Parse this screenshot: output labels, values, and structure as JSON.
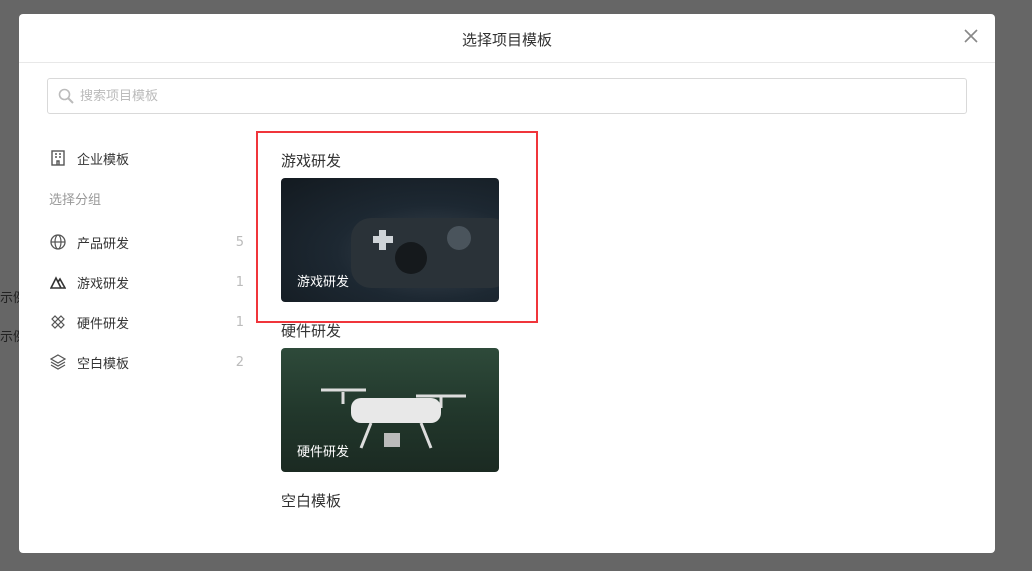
{
  "background": {
    "fragments": [
      "示例",
      "示例"
    ]
  },
  "modal": {
    "title": "选择项目模板",
    "search_placeholder": "搜索项目模板",
    "sidebar": {
      "enterprise": "企业模板",
      "group_heading": "选择分组",
      "items": [
        {
          "label": "产品研发",
          "count": "5",
          "icon": "globe-icon"
        },
        {
          "label": "游戏研发",
          "count": "1",
          "icon": "mountain-icon"
        },
        {
          "label": "硬件研发",
          "count": "1",
          "icon": "tools-icon"
        },
        {
          "label": "空白模板",
          "count": "2",
          "icon": "layers-icon"
        }
      ]
    },
    "sections": [
      {
        "title": "游戏研发",
        "card": "游戏研发"
      },
      {
        "title": "硬件研发",
        "card": "硬件研发"
      },
      {
        "title": "空白模板"
      }
    ]
  },
  "colors": {
    "highlight": "#f0353b"
  }
}
